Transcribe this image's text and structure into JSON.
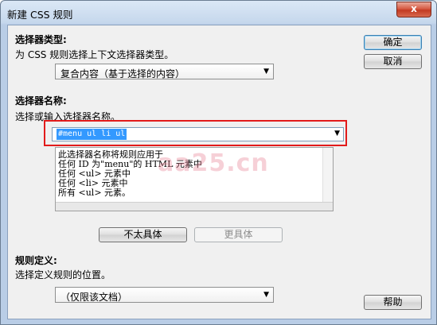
{
  "window": {
    "title": "新建 CSS 规则",
    "close_label": "x"
  },
  "selector_type": {
    "heading": "选择器类型:",
    "description": "为 CSS 规则选择上下文选择器类型。",
    "value": "复合内容（基于选择的内容）"
  },
  "selector_name": {
    "heading": "选择器名称:",
    "description": "选择或输入选择器名称。",
    "value": "#menu ul li ul",
    "description_lines": [
      "此选择器名称将规则应用于",
      "任何 ID 为\"menu\"的 HTML 元素中",
      "任何 <ul> 元素中",
      "任何 <li> 元素中",
      "所有 <ul> 元素。"
    ],
    "less_specific_label": "不太具体",
    "more_specific_label": "更具体"
  },
  "rule_definition": {
    "heading": "规则定义:",
    "description": "选择定义规则的位置。",
    "value": "（仅限该文档）"
  },
  "buttons": {
    "ok": "确定",
    "cancel": "取消",
    "help": "帮助"
  },
  "watermark": "aa25.cn",
  "icons": {
    "dropdown_arrow": "▼"
  }
}
